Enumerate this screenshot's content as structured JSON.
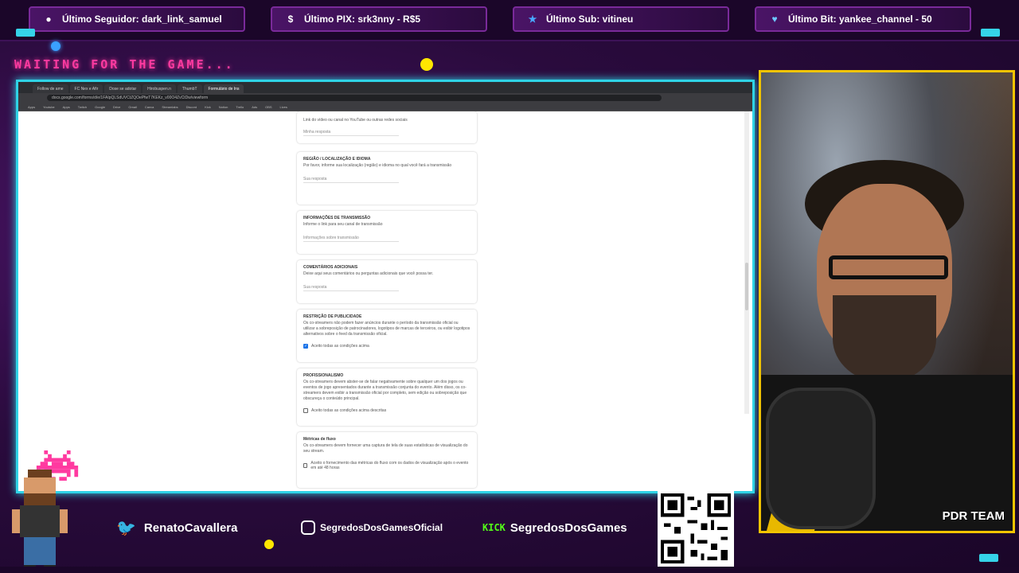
{
  "alerts": [
    {
      "label": "Último Seguidor: dark_link_samuel",
      "icon": "user-icon"
    },
    {
      "label": "Último PIX: srk3nny - R$5",
      "icon": "dollar-icon"
    },
    {
      "label": "Último Sub: vitineu",
      "icon": "star-icon"
    },
    {
      "label": "Último Bit: yankee_channel - 50",
      "icon": "diamond-icon"
    }
  ],
  "waiting_text": "WAITING FOR THE GAME...",
  "browser": {
    "tabs": [
      "Follow de ame",
      "FC Nex e Afir",
      "Dose se adotar",
      "Hirobuspen.n",
      "ThumbT",
      "Formulário de Ins"
    ],
    "url": "docs.google.com/forms/d/e/1FAIpQLSdUVCtZQOePfwT7KEKz_v00O4ZvCtDw/viewform",
    "bookmarks": [
      "Apps",
      "Youtube",
      "Apps",
      "Twitch",
      "Google",
      "Drive",
      "Gmail",
      "Canva",
      "Streamlabs",
      "Discord",
      "Kick",
      "Notion",
      "Trello",
      "Ads",
      "OBS",
      "Lives"
    ]
  },
  "form": {
    "sections": [
      {
        "title": "",
        "text": "Link do vídeo ou canal no YouTube ou outras redes sociais",
        "answer": "Minha resposta"
      },
      {
        "title": "REGIÃO / LOCALIZAÇÃO E IDIOMA",
        "text": "Por favor, informe sua localização (região) e idioma no qual você fará a transmissão",
        "answer": "Sua resposta"
      },
      {
        "title": "INFORMAÇÕES DE TRANSMISSÃO",
        "text": "Informe o link para seu canal de transmissão",
        "answer": "Informações sobre transmissão"
      },
      {
        "title": "COMENTÁRIOS ADICIONAIS",
        "text": "Deixe aqui seus comentários ou perguntas adicionais que você possa ter.",
        "answer": "Sua resposta"
      }
    ],
    "publicity": {
      "title": "RESTRIÇÃO DE PUBLICIDADE",
      "text": "Os co-streamers não podem fazer anúncios durante o período da transmissão oficial ou utilizar a sobreposição de patrocinadores, logotipos de marcas de terceiros, ou exibir logotipos alternativos sobre o feed da transmissão oficial.",
      "check": "Aceito todas as condições acima"
    },
    "professional": {
      "title": "PROFISSIONALISMO",
      "text": "Os co-streamers devem abster-se de falar negativamente sobre qualquer um dos jogos ou eventos de jogo apresentados durante a transmissão conjunta do evento. Além disso, os co-streamers devem exibir a transmissão oficial por completo, sem edição ou sobreposição que obscureça o conteúdo principal.",
      "check": "Aceito todas as condições acima descritas"
    },
    "metrics": {
      "title": "Métricas de fluxo",
      "text": "Os co-streamers devem fornecer uma captura de tela de suas estatísticas de visualização do seu stream.",
      "check": "Aceito o fornecimento das métricas do fluxo com os dados de visualização após o evento em até 48 horas"
    }
  },
  "webcam": {
    "badge": "PDR TEAM"
  },
  "socials": {
    "twitter": "RenatoCavallera",
    "instagram": "SegredosDosGamesOficial",
    "kick_tag": "KICK",
    "kick": "SegredosDosGames"
  },
  "livepix": "livepix.gg/segredosdosgames",
  "colors": {
    "accent": "#2fd3e6",
    "pink": "#ff3aa0",
    "cam_border": "#f2c400",
    "kick": "#53fc18"
  }
}
